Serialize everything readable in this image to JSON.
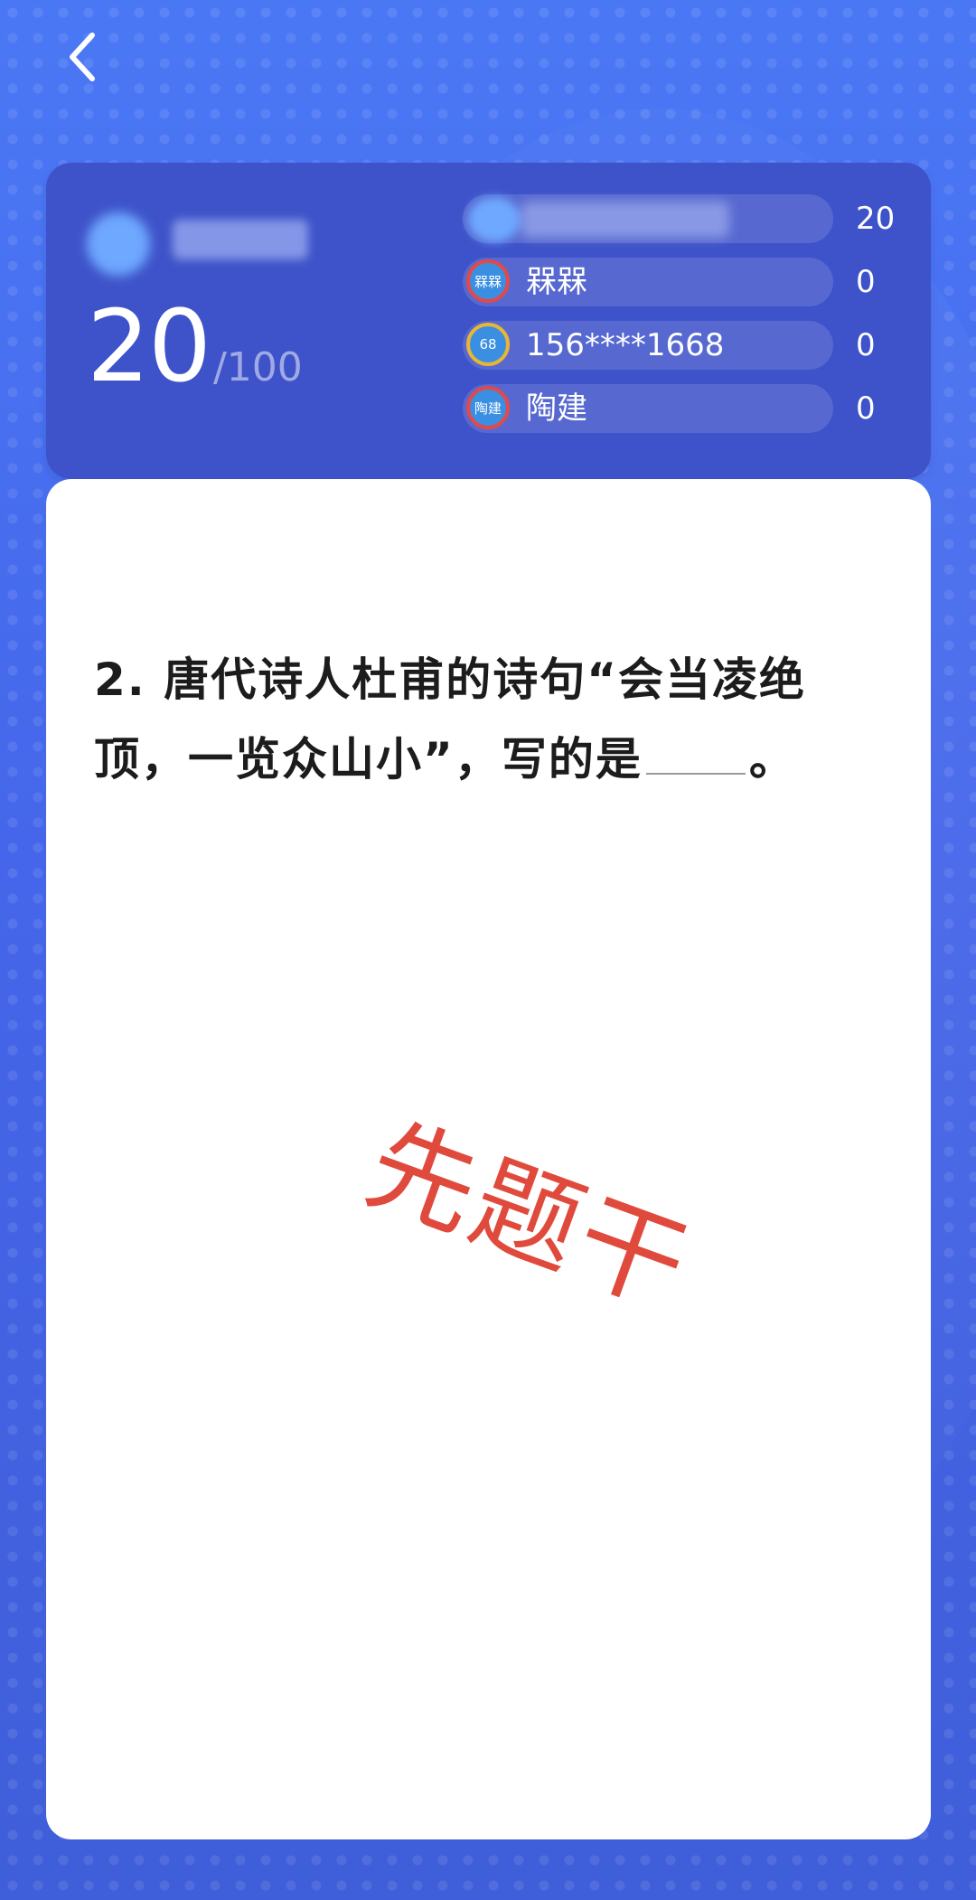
{
  "header": {
    "back_icon": "chevron-left-icon"
  },
  "scoreboard": {
    "my_score": "20",
    "max_score": "/100",
    "players": [
      {
        "name": "",
        "score": "20",
        "avatar_text": "",
        "blurred": true
      },
      {
        "name": "槑槑",
        "score": "0",
        "avatar_text": "槑槑",
        "blurred": false
      },
      {
        "name": "156****1668",
        "score": "0",
        "avatar_text": "68",
        "blurred": false
      },
      {
        "name": "陶建",
        "score": "0",
        "avatar_text": "陶建",
        "blurred": false
      }
    ]
  },
  "question": {
    "text_before": "2. 唐代诗人杜甫的诗句“会当凌绝顶，一览众山小”，写的是",
    "text_after": "。",
    "stamp": "先题干"
  },
  "colors": {
    "background": "#4a78f5",
    "panel": "#3e53c9",
    "stamp": "#e04a3c",
    "avatar_ring_red": "#e24a4a",
    "avatar_ring_gold": "#e8b534"
  }
}
